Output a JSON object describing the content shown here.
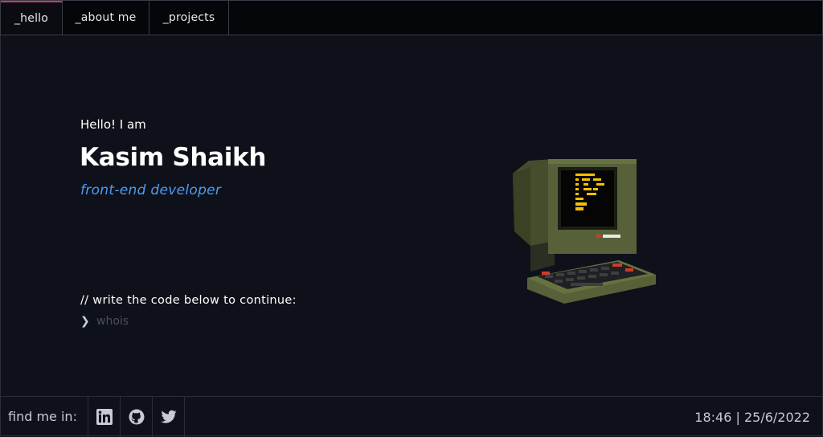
{
  "nav": {
    "tabs": [
      {
        "label": "_hello"
      },
      {
        "label": "_about me"
      },
      {
        "label": "_projects"
      }
    ]
  },
  "hero": {
    "greeting": "Hello! I am",
    "name": "Kasim Shaikh",
    "role": "front-end developer",
    "prompt_label": "//  write the code below to continue:",
    "prompt_chevron": "❯",
    "command_placeholder": "whois"
  },
  "footer": {
    "find_label": "find me in:",
    "socials": [
      {
        "icon": "linkedin-icon"
      },
      {
        "icon": "github-icon"
      },
      {
        "icon": "twitter-icon"
      }
    ],
    "clock": "18:46 | 25/6/2022"
  },
  "colors": {
    "background": "#0f111a",
    "active_tab_accent": "#c6396d",
    "role_blue": "#4d9cf0",
    "screen_text": "#f2c200",
    "computer_body": "#56613a"
  }
}
